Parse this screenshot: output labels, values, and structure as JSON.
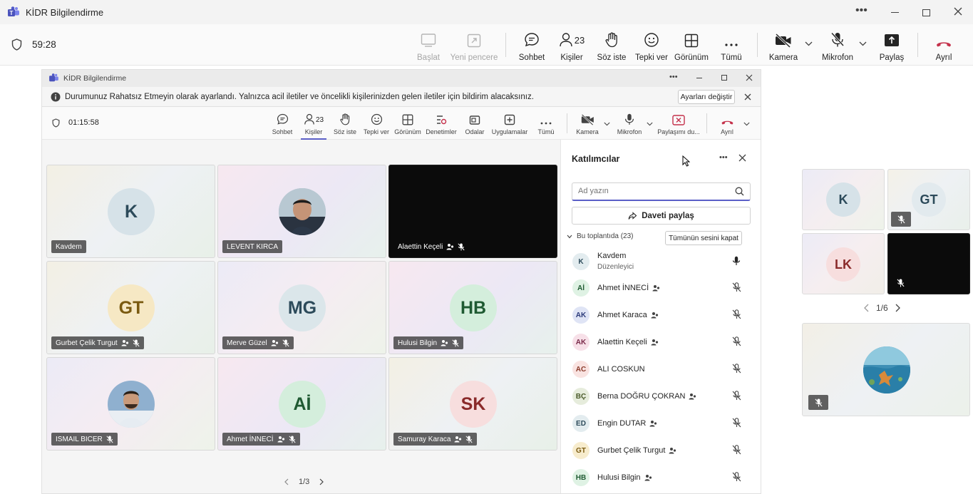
{
  "window": {
    "title": "KİDR Bilgilendirme"
  },
  "toolbar": {
    "timer": "59:28",
    "start": "Başlat",
    "new_window": "Yeni pencere",
    "chat": "Sohbet",
    "people": "Kişiler",
    "people_count": "23",
    "raise_hand": "Söz iste",
    "react": "Tepki ver",
    "view": "Görünüm",
    "more": "Tümü",
    "camera": "Kamera",
    "mic": "Mikrofon",
    "share": "Paylaş",
    "leave": "Ayrıl"
  },
  "inner": {
    "title": "KİDR Bilgilendirme",
    "notification": "Durumunuz Rahatsız Etmeyin olarak ayarlandı. Yalnızca acil iletiler ve öncelikli kişilerinizden gelen iletiler için bildirim alacaksınız.",
    "change_settings": "Ayarları değiştir",
    "timer": "01:15:58",
    "toolbar": {
      "chat": "Sohbet",
      "people": "Kişiler",
      "people_count": "23",
      "raise_hand": "Söz iste",
      "react": "Tepki ver",
      "view": "Görünüm",
      "notes": "Denetimler",
      "rooms": "Odalar",
      "apps": "Uygulamalar",
      "more": "Tümü",
      "camera": "Kamera",
      "mic": "Mikrofon",
      "share_stop": "Paylaşımı du...",
      "leave": "Ayrıl"
    },
    "tiles": [
      {
        "name": "Kavdem",
        "initials": "K",
        "avatar_bg": "#d6e2e8",
        "avatar_fg": "#2c4a5a"
      },
      {
        "name": "LEVENT KIRCA",
        "initials": "",
        "avatar_bg": "#7a8c8c",
        "avatar_fg": "#ffffff"
      },
      {
        "name": "Alaettin Keçeli",
        "initials": "",
        "avatar_bg": "#000000",
        "avatar_fg": "#ffffff"
      },
      {
        "name": "Gurbet Çelik Turgut",
        "initials": "GT",
        "avatar_bg": "#f6e8c4",
        "avatar_fg": "#7a5a10"
      },
      {
        "name": "Merve Güzel",
        "initials": "MG",
        "avatar_bg": "#dbe6ea",
        "avatar_fg": "#2c4a5a"
      },
      {
        "name": "Hulusi Bilgin",
        "initials": "HB",
        "avatar_bg": "#d4eedc",
        "avatar_fg": "#1f5a32"
      },
      {
        "name": "ISMAIL BICER",
        "initials": "",
        "avatar_bg": "#6d8fb0",
        "avatar_fg": "#ffffff"
      },
      {
        "name": "Ahmet İNNECİ",
        "initials": "Aİ",
        "avatar_bg": "#d4eedc",
        "avatar_fg": "#1f5a32"
      },
      {
        "name": "Samuray Karaca",
        "initials": "SK",
        "avatar_bg": "#f7dede",
        "avatar_fg": "#8a2a2a"
      }
    ],
    "pager": "1/3"
  },
  "panel": {
    "title": "Katılımcılar",
    "search_placeholder": "Ad yazın",
    "invite": "Daveti paylaş",
    "section": "Bu toplantıda (23)",
    "mute_all": "Tümünün sesini kapat",
    "participants": [
      {
        "initials": "K",
        "name": "Kavdem",
        "role": "Düzenleyici",
        "bg": "#e3ecef",
        "fg": "#2c4a5a"
      },
      {
        "initials": "Aİ",
        "name": "Ahmet İNNECİ",
        "role": "",
        "bg": "#dff2e4",
        "fg": "#1f5a32"
      },
      {
        "initials": "AK",
        "name": "Ahmet Karaca",
        "role": "",
        "bg": "#dfe4f5",
        "fg": "#2b3a7a"
      },
      {
        "initials": "AK",
        "name": "Alaettin Keçeli",
        "role": "",
        "bg": "#f7e0e8",
        "fg": "#7a2a4a"
      },
      {
        "initials": "AC",
        "name": "ALI COSKUN",
        "role": "",
        "bg": "#f9e3e1",
        "fg": "#8a3a2a"
      },
      {
        "initials": "BÇ",
        "name": "Berna DOĞRU ÇOKRAN",
        "role": "",
        "bg": "#e6ecdc",
        "fg": "#4a5a2a"
      },
      {
        "initials": "ED",
        "name": "Engin DUTAR",
        "role": "",
        "bg": "#e3ecef",
        "fg": "#2c4a5a"
      },
      {
        "initials": "GT",
        "name": "Gurbet Çelik Turgut",
        "role": "",
        "bg": "#f7eccd",
        "fg": "#7a5a10"
      },
      {
        "initials": "HB",
        "name": "Hulusi Bilgin",
        "role": "",
        "bg": "#dff2e4",
        "fg": "#1f5a32"
      }
    ]
  },
  "right": {
    "tiles": [
      {
        "initials": "K",
        "bg": "#d6e2e8",
        "fg": "#2c4a5a"
      },
      {
        "initials": "GT",
        "bg": "#e2eaee",
        "fg": "#2c4a5a"
      },
      {
        "initials": "LK",
        "bg": "#f7dede",
        "fg": "#8a2a2a"
      }
    ],
    "pager": "1/6"
  }
}
